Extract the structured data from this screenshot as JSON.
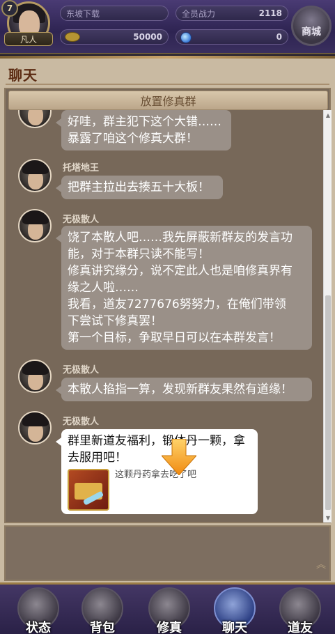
{
  "header": {
    "level_badge": "7",
    "rank_label": "凡人",
    "download_label": "东坡下载",
    "power_label": "全员战力",
    "power_value": "2118",
    "coins_value": "50000",
    "gems_value": "0",
    "shop_label": "商城"
  },
  "panel": {
    "title": "聊天",
    "group_name": "放置修真群"
  },
  "messages": [
    {
      "sender": "",
      "lines": [
        "好哇，群主犯下这个大错……",
        "暴露了咱这个修真大群！"
      ]
    },
    {
      "sender": "托塔地王",
      "lines": [
        "把群主拉出去揍五十大板！"
      ]
    },
    {
      "sender": "无极散人",
      "lines": [
        "饶了本散人吧……我先屏蔽新群友的发言功",
        "能，对于本群只读不能写！",
        "修真讲究缘分，说不定此人也是咱修真界有",
        "缘之人啦……",
        "我看，道友7277676努努力，在俺们带领",
        "下尝试下修真罢！",
        "第一个目标，争取早日可以在本群发言！"
      ]
    },
    {
      "sender": "无极散人",
      "lines": [
        "本散人掐指一算，发现新群友果然有道缘！"
      ]
    },
    {
      "sender": "无极散人",
      "lines": [
        "群里新道友福利，锻体丹一颗，拿",
        "去服用吧！"
      ],
      "reward_text": "这颗丹药拿去吃了吧"
    }
  ],
  "nav": [
    "状态",
    "背包",
    "修真",
    "聊天",
    "道友"
  ],
  "colors": {
    "panel_bg": "#c9baa2",
    "chat_bg": "#776859",
    "bubble_gray": "#9a9088",
    "bubble_white": "#ffffff",
    "arrow": "#f4a51c"
  },
  "icons": [
    "coin-icon",
    "gem-icon",
    "shop-icon",
    "arrow-down-icon",
    "chest-icon",
    "collapse-up-icon"
  ]
}
